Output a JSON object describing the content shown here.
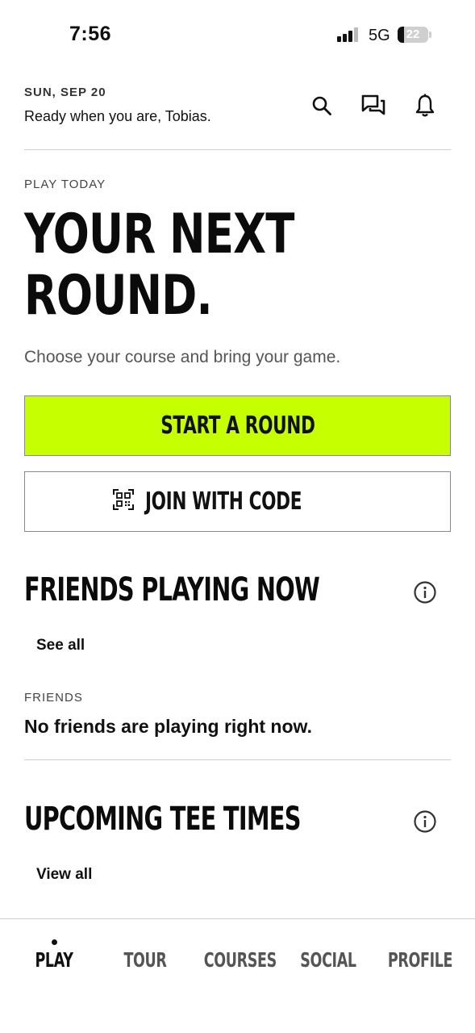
{
  "status_bar": {
    "time": "7:56",
    "network": "5G",
    "battery": "22",
    "battery_level": 0.22
  },
  "header": {
    "date": "SUN, SEP 20",
    "greeting": "Ready when you are, Tobias.",
    "icons": [
      "search-icon",
      "chat-icon",
      "bell-icon"
    ]
  },
  "hero": {
    "eyebrow": "PLAY TODAY",
    "title_line1": "YOUR NEXT",
    "title_line2": "ROUND.",
    "subtitle": "Choose your course and bring your game.",
    "primary_button": "START A ROUND",
    "secondary_button": "JOIN WITH CODE",
    "secondary_icon": "qr-code-icon"
  },
  "friends_section": {
    "title": "FRIENDS PLAYING NOW",
    "link": "See all",
    "label": "FRIENDS",
    "empty_message": "No friends are playing right now."
  },
  "tee_times_section": {
    "title": "UPCOMING TEE TIMES",
    "link": "View all"
  },
  "tabs": [
    {
      "label": "PLAY",
      "active": true
    },
    {
      "label": "TOUR",
      "active": false
    },
    {
      "label": "COURSES",
      "active": false
    },
    {
      "label": "SOCIAL",
      "active": false
    },
    {
      "label": "PROFILE",
      "active": false
    }
  ],
  "colors": {
    "accent": "#c6ff00",
    "text": "#111111",
    "divider": "#cfcfcf"
  }
}
